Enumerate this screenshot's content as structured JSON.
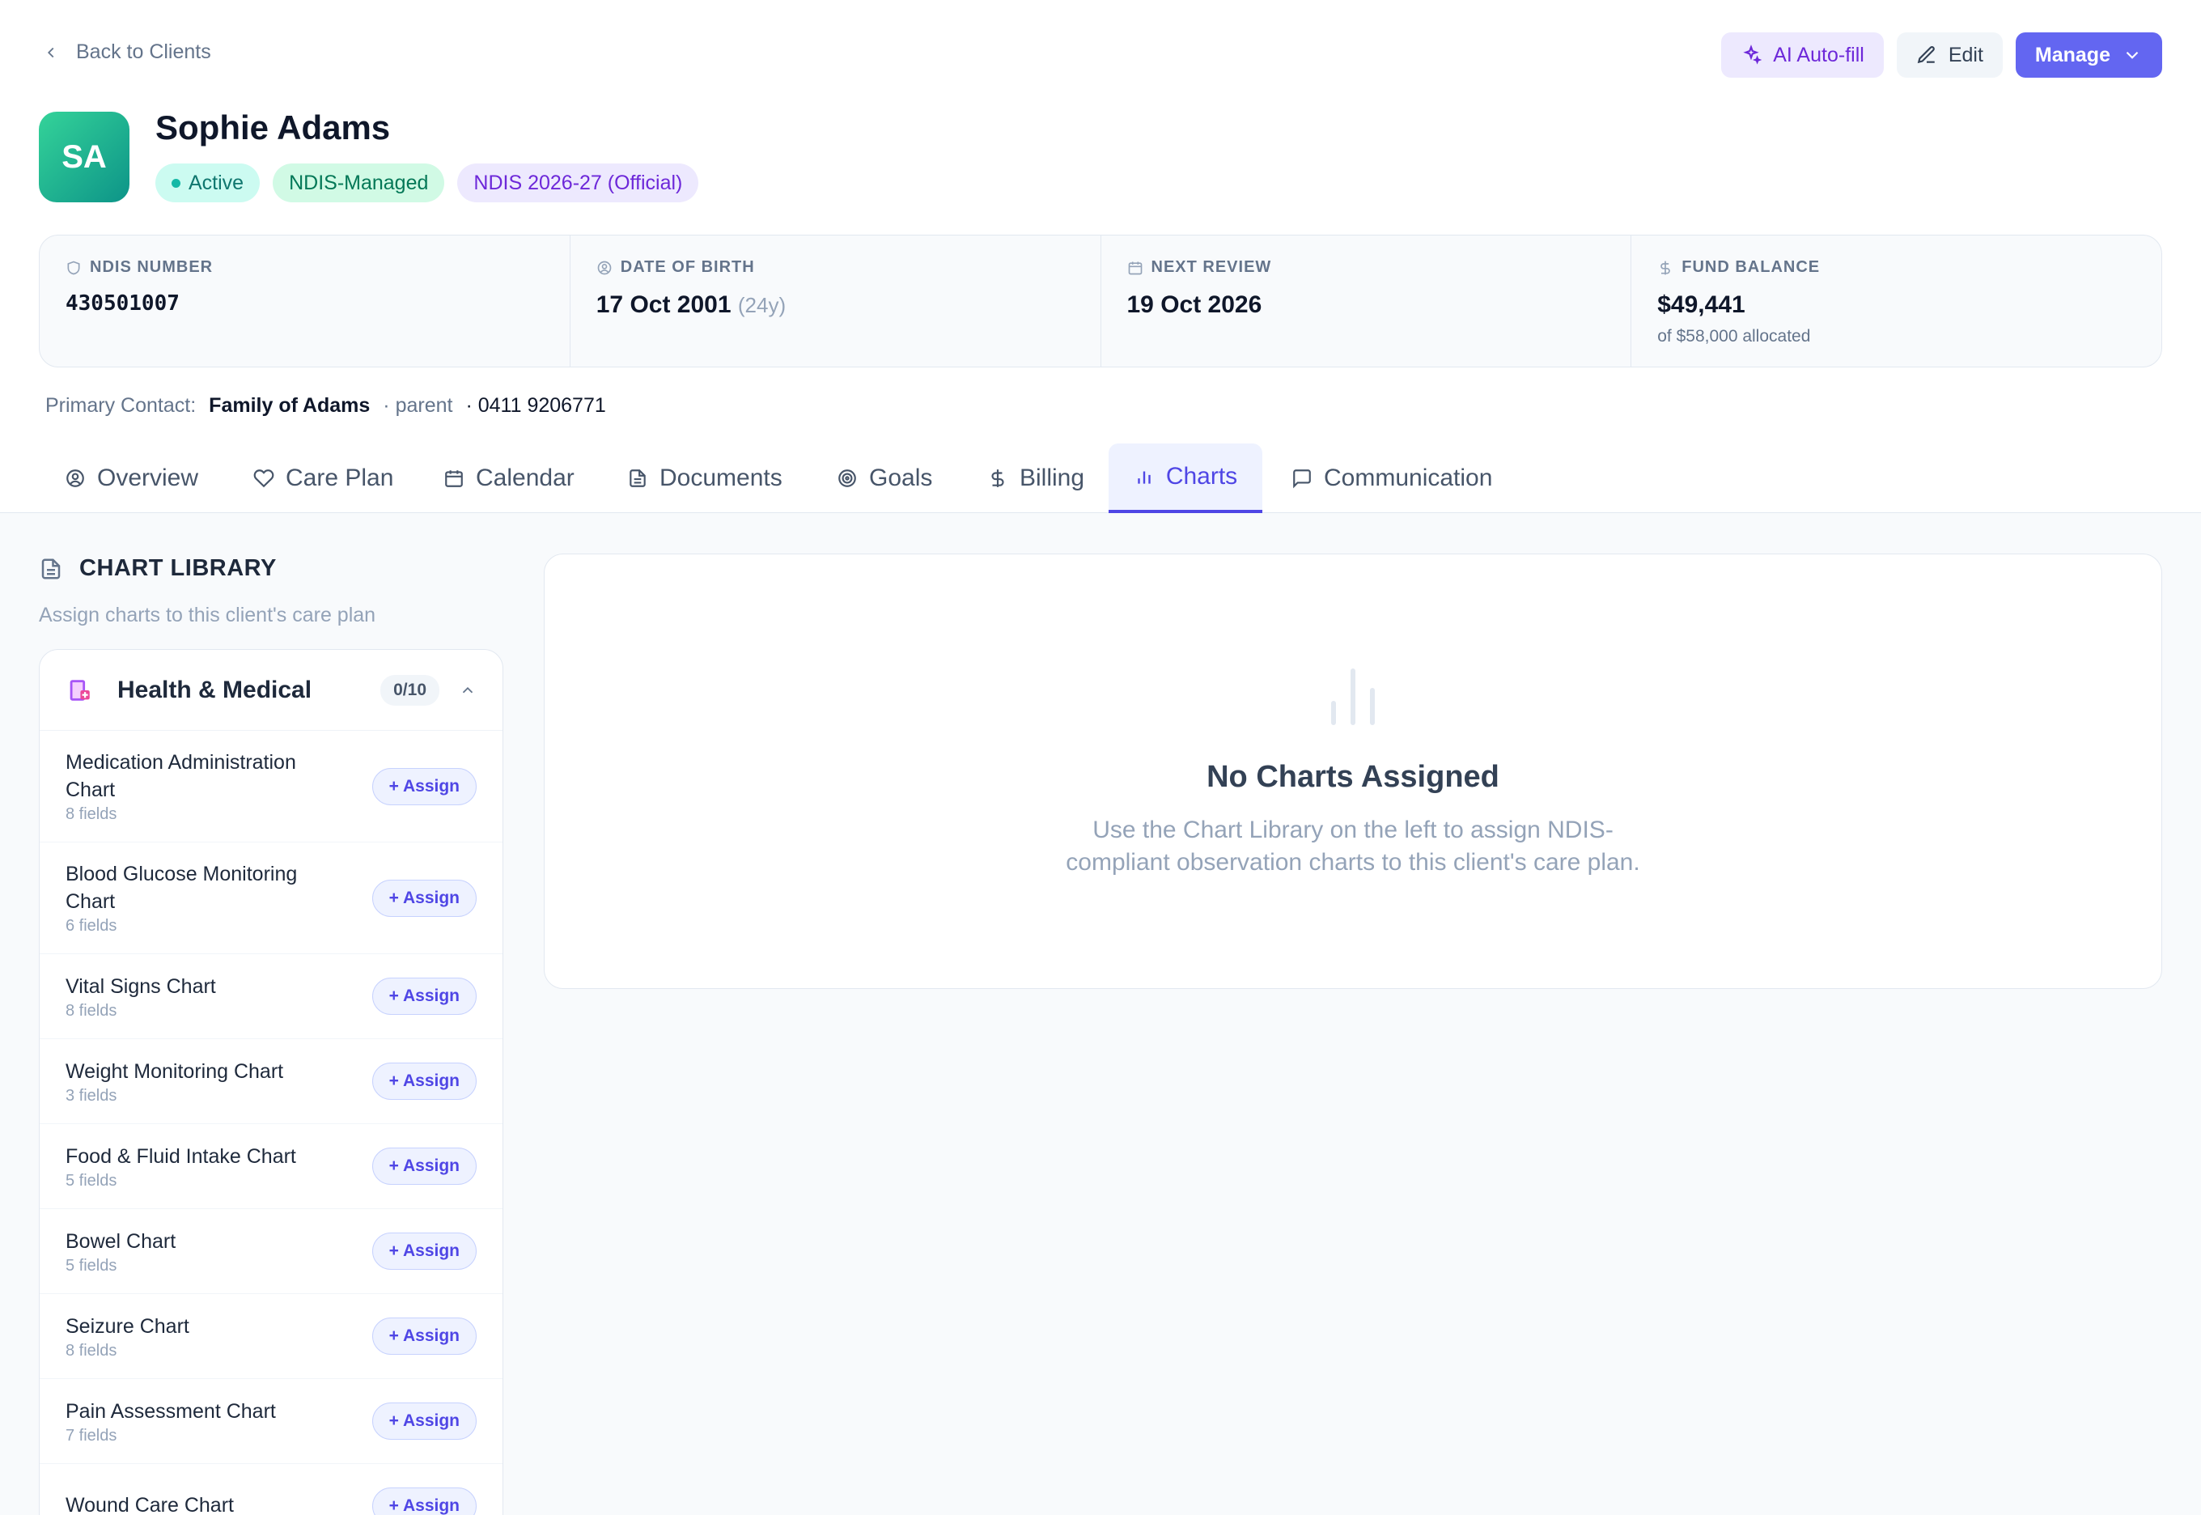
{
  "nav": {
    "back_label": "Back to Clients"
  },
  "actions": {
    "ai_label": "AI Auto-fill",
    "edit_label": "Edit",
    "manage_label": "Manage"
  },
  "client": {
    "initials": "SA",
    "name": "Sophie Adams",
    "badges": {
      "status": "Active",
      "management": "NDIS-Managed",
      "plan": "NDIS 2026-27 (Official)"
    }
  },
  "stats": {
    "ndis": {
      "label": "NDIS NUMBER",
      "value": "430501007"
    },
    "dob": {
      "label": "DATE OF BIRTH",
      "value": "17 Oct 2001",
      "age": "(24y)"
    },
    "review": {
      "label": "NEXT REVIEW",
      "value": "19 Oct 2026"
    },
    "fund": {
      "label": "FUND BALANCE",
      "value": "$49,441",
      "note": "of $58,000 allocated"
    }
  },
  "contact": {
    "label": "Primary Contact:",
    "name": "Family of Adams",
    "relation": "· parent",
    "phone": "· 0411 9206771"
  },
  "tabs": [
    {
      "label": "Overview",
      "icon": "user-circle-icon"
    },
    {
      "label": "Care Plan",
      "icon": "heart-icon"
    },
    {
      "label": "Calendar",
      "icon": "calendar-icon"
    },
    {
      "label": "Documents",
      "icon": "document-icon"
    },
    {
      "label": "Goals",
      "icon": "target-icon"
    },
    {
      "label": "Billing",
      "icon": "dollar-icon"
    },
    {
      "label": "Charts",
      "icon": "bar-chart-icon",
      "active": true
    },
    {
      "label": "Communication",
      "icon": "message-icon"
    }
  ],
  "library": {
    "title": "CHART LIBRARY",
    "subtitle": "Assign charts to this client's care plan",
    "category": {
      "name": "Health & Medical",
      "count": "0/10"
    },
    "assign_label": "+ Assign",
    "items": [
      {
        "name": "Medication Administration Chart",
        "fields": "8 fields"
      },
      {
        "name": "Blood Glucose Monitoring Chart",
        "fields": "6 fields"
      },
      {
        "name": "Vital Signs Chart",
        "fields": "8 fields"
      },
      {
        "name": "Weight Monitoring Chart",
        "fields": "3 fields"
      },
      {
        "name": "Food & Fluid Intake Chart",
        "fields": "5 fields"
      },
      {
        "name": "Bowel Chart",
        "fields": "5 fields"
      },
      {
        "name": "Seizure Chart",
        "fields": "8 fields"
      },
      {
        "name": "Pain Assessment Chart",
        "fields": "7 fields"
      },
      {
        "name": "Wound Care Chart",
        "fields": ""
      }
    ]
  },
  "empty": {
    "title": "No Charts Assigned",
    "text": "Use the Chart Library on the left to assign NDIS-compliant observation charts to this client's care plan."
  },
  "colors": {
    "accent": "#6366f1",
    "avatar": "#10b981",
    "active_tab": "#4f46e5"
  }
}
